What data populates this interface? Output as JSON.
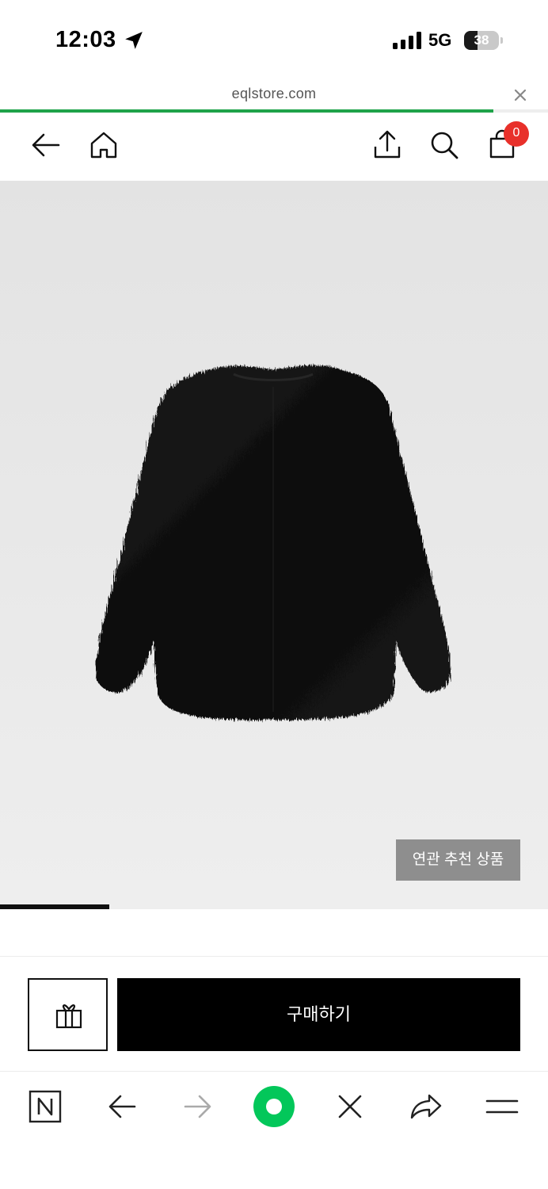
{
  "status_bar": {
    "time": "12:03",
    "network": "5G",
    "battery_percent": "38",
    "battery_level": 0.38,
    "icons": [
      "location-arrow-icon",
      "signal-bars-icon",
      "battery-icon"
    ]
  },
  "browser": {
    "url": "eqlstore.com",
    "load_progress": 0.9,
    "close_icon": "close-icon",
    "toolbar_icons": [
      "naver-n-icon",
      "back-arrow-icon",
      "forward-arrow-icon",
      "green-home-dot-icon",
      "close-icon",
      "share-arrow-icon",
      "menu-icon"
    ]
  },
  "header": {
    "icons": [
      "back-arrow-icon",
      "home-icon",
      "share-upload-icon",
      "search-icon",
      "shopping-bag-icon"
    ],
    "cart_count": "0"
  },
  "product": {
    "image": "black-faux-fur-jacket",
    "related_button": "연관 추천 상품",
    "carousel_position": 0.2
  },
  "purchase": {
    "gift_icon": "gift-icon",
    "buy_label": "구매하기"
  },
  "colors": {
    "accent_green": "#1fa34a",
    "badge_red": "#e8302a",
    "naver_green": "#03c75a",
    "buy_button": "#000000"
  }
}
